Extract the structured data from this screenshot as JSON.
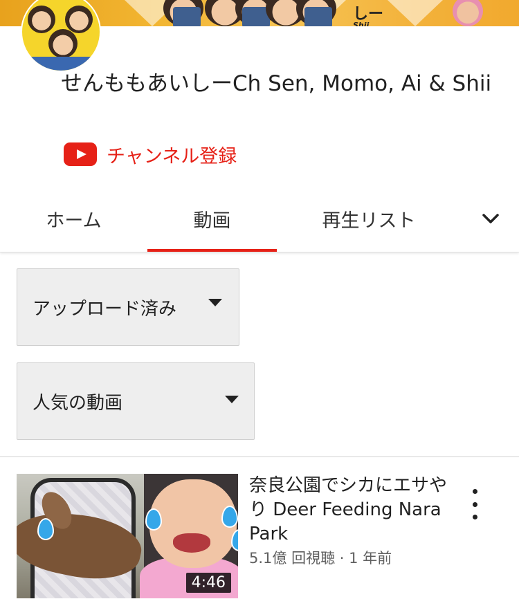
{
  "channel": {
    "name": "せんももあいしーCh Sen, Momo, Ai & Shii",
    "subscribe_label": "チャンネル登録",
    "banner_text": "しー",
    "banner_subtext": "Shii"
  },
  "tabs": [
    {
      "label": "ホーム",
      "selected": false
    },
    {
      "label": "動画",
      "selected": true
    },
    {
      "label": "再生リスト",
      "selected": false
    }
  ],
  "filters": {
    "sort_type": "アップロード済み",
    "sort_order": "人気の動画"
  },
  "videos": [
    {
      "title": "奈良公園でシカにエサやり Deer Feeding Nara Park",
      "meta": "5.1億 回視聴 · 1 年前",
      "duration": "4:46"
    }
  ],
  "colors": {
    "accent_red": "#e62117",
    "dropdown_bg": "#eeeeee"
  },
  "icons": [
    "youtube-logo-icon",
    "chevron-down-icon",
    "caret-down-icon",
    "more-vert-icon"
  ]
}
